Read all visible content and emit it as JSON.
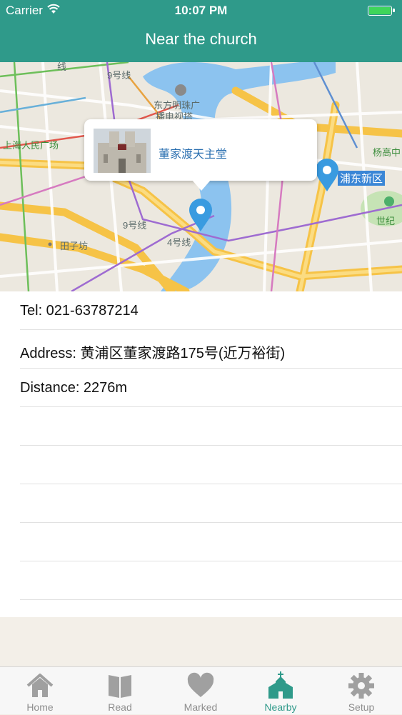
{
  "status_bar": {
    "carrier": "Carrier",
    "time": "10:07 PM"
  },
  "nav": {
    "title": "Near the church"
  },
  "map": {
    "callout": {
      "name": "董家渡天主堂"
    },
    "labels": {
      "line9_top": "9号线",
      "oriental_pearl": "东方明珠广",
      "oriental_pearl_2": "播电视塔",
      "peoples_square": "上海人民广场",
      "yanggao": "杨高中",
      "pudong": "浦东新区",
      "century": "世纪",
      "line9_mid": "9号线",
      "line4": "4号线",
      "tianzifang": "田子坊",
      "line4_top": "线"
    }
  },
  "details": {
    "tel": "Tel: 021-63787214",
    "address": "Address: 黄浦区董家渡路175号(近万裕街)",
    "distance": "Distance: 2276m"
  },
  "tabs": [
    {
      "label": "Home",
      "icon": "house-icon",
      "active": false
    },
    {
      "label": "Read",
      "icon": "book-icon",
      "active": false
    },
    {
      "label": "Marked",
      "icon": "heart-icon",
      "active": false
    },
    {
      "label": "Nearby",
      "icon": "church-icon",
      "active": true
    },
    {
      "label": "Setup",
      "icon": "gear-icon",
      "active": false
    }
  ],
  "colors": {
    "header": "#2f9a8a",
    "active_tab": "#2f9a8a",
    "pin": "#3a9be0",
    "river": "#8cc3ef"
  }
}
